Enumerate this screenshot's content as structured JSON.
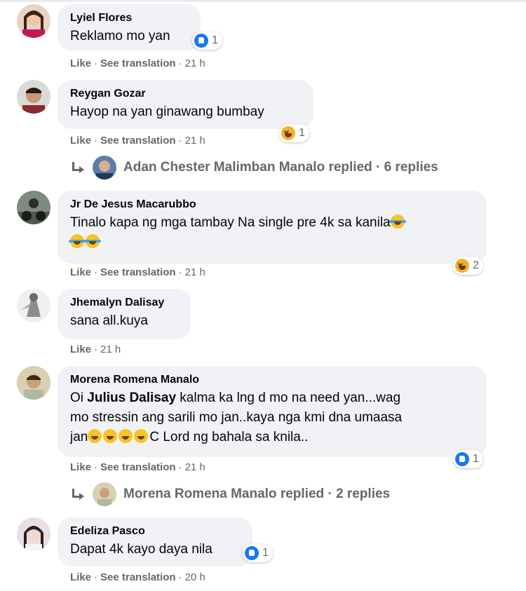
{
  "comments": [
    {
      "author": "Lyiel Flores",
      "text": "Reklamo mo yan",
      "like": "Like",
      "translate": "See translation",
      "time": "21 h",
      "reaction": "like",
      "count": "1"
    },
    {
      "author": "Reygan Gozar",
      "text": "Hayop na yan ginawang bumbay",
      "like": "Like",
      "translate": "See translation",
      "time": "21 h",
      "reaction": "haha",
      "count": "1",
      "replies": "Adan Chester Malimban Manalo replied · 6 replies"
    },
    {
      "author": "Jr De Jesus Macarubbo",
      "text": "Tinalo kapa ng mga tambay Na single pre 4k sa kanila",
      "like": "Like",
      "translate": "See translation",
      "time": "21 h",
      "reaction": "haha",
      "count": "2"
    },
    {
      "author": "Jhemalyn Dalisay",
      "text": "sana all.kuya",
      "like": "Like",
      "time": "21 h"
    },
    {
      "author": "Morena Romena Manalo",
      "mention": "Julius Dalisay",
      "text_a": " kalma ka lng d mo na need yan...wag",
      "text_b": "mo stressin ang sarili mo jan..kaya nga kmi dna umaasa",
      "text_c_pre": "jan",
      "text_c_post": "C Lord ng bahala sa knila..",
      "text_prefix": "Oi ",
      "like": "Like",
      "translate": "See translation",
      "time": "21 h",
      "reaction": "like",
      "count": "1",
      "replies": "Morena Romena Manalo replied · 2 replies"
    },
    {
      "author": "Edeliza Pasco",
      "text": "Dapat 4k kayo daya nila",
      "like": "Like",
      "translate": "See translation",
      "time": "20 h",
      "reaction": "like",
      "count": "1"
    }
  ],
  "colors": {
    "bubble": "#f0f2f5",
    "meta": "#65676b",
    "like_blue": "#1877f2",
    "haha_yellow": "#f7b125"
  }
}
